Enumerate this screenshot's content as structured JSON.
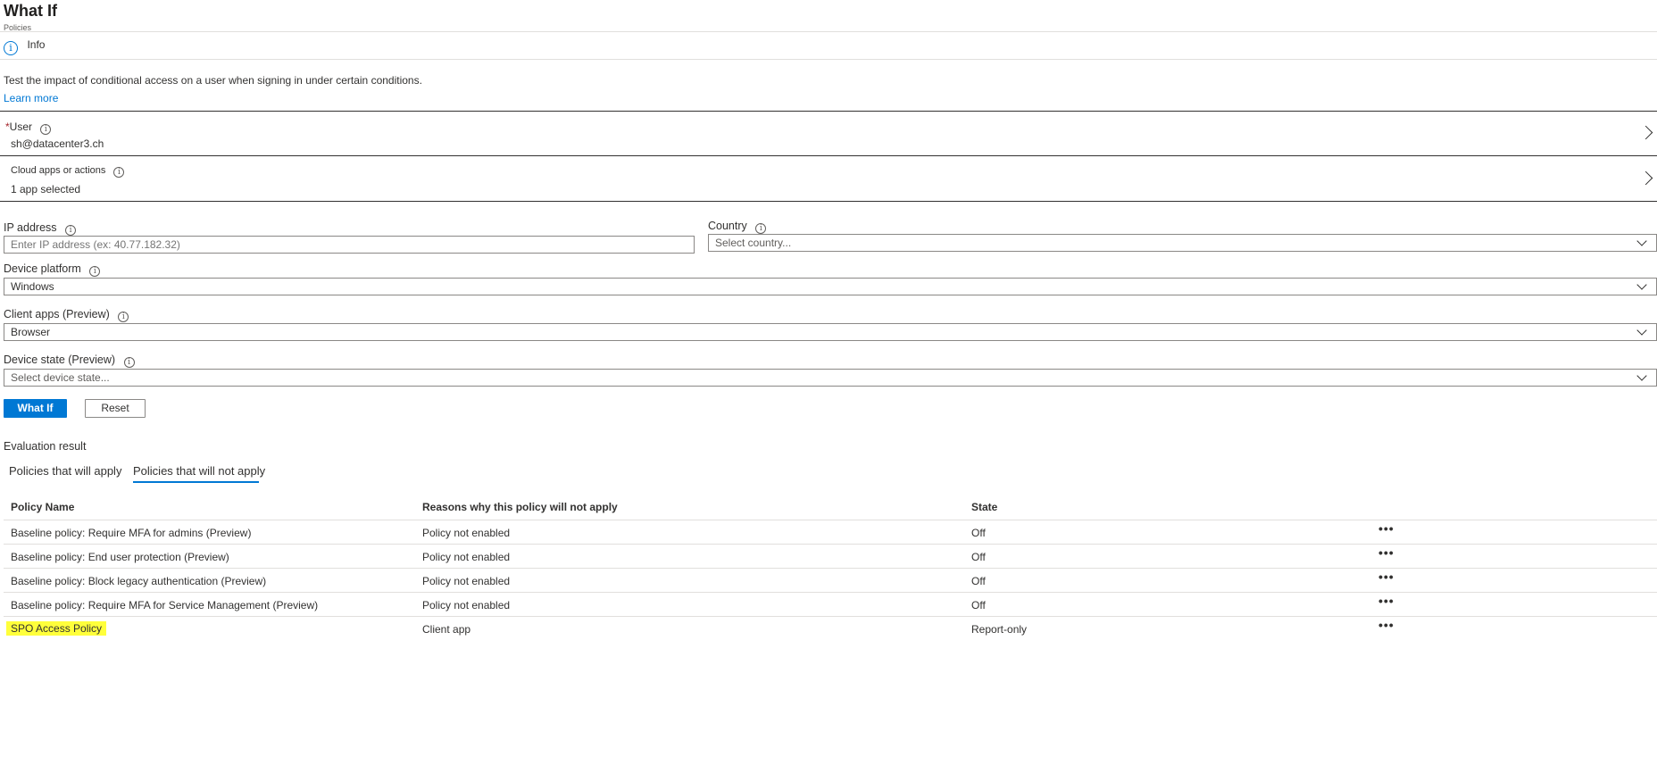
{
  "header": {
    "title": "What If",
    "subtitle": "Policies"
  },
  "info_bar": {
    "label": "Info",
    "icon": "info-icon"
  },
  "description": {
    "text": "Test the impact of conditional access on a user when signing in under certain conditions.",
    "link": "Learn more"
  },
  "user_field": {
    "required_mark": "*",
    "label": "User",
    "value": "sh@datacenter3.ch"
  },
  "cloud_apps_field": {
    "label": "Cloud apps or actions",
    "value": "1 app selected"
  },
  "ip_address": {
    "label": "IP address",
    "placeholder": "Enter IP address (ex: 40.77.182.32)"
  },
  "country": {
    "label": "Country",
    "placeholder": "Select country..."
  },
  "device_platform": {
    "label": "Device platform",
    "value": "Windows"
  },
  "client_apps": {
    "label": "Client apps (Preview)",
    "value": "Browser"
  },
  "device_state": {
    "label": "Device state (Preview)",
    "placeholder": "Select device state..."
  },
  "buttons": {
    "what_if": "What If",
    "reset": "Reset"
  },
  "evaluation": {
    "heading": "Evaluation result",
    "tabs": [
      {
        "label": "Policies that will apply",
        "active": false
      },
      {
        "label": "Policies that will not apply",
        "active": true
      }
    ]
  },
  "table": {
    "columns": [
      "Policy Name",
      "Reasons why this policy will not apply",
      "State"
    ],
    "rows": [
      {
        "name": "Baseline policy: Require MFA for admins (Preview)",
        "reason": "Policy not enabled",
        "state": "Off",
        "more": "•••"
      },
      {
        "name": "Baseline policy: End user protection (Preview)",
        "reason": "Policy not enabled",
        "state": "Off",
        "more": "•••"
      },
      {
        "name": "Baseline policy: Block legacy authentication (Preview)",
        "reason": "Policy not enabled",
        "state": "Off",
        "more": "•••"
      },
      {
        "name": "Baseline policy: Require MFA for Service Management (Preview)",
        "reason": "Policy not enabled",
        "state": "Off",
        "more": "•••"
      },
      {
        "name": "SPO Access Policy",
        "reason": "Client app",
        "state": "Report-only",
        "more": "•••",
        "highlight_color": "#ffff3b"
      }
    ]
  },
  "colors": {
    "accent": "#0078d4",
    "highlight": "#ffff3b"
  }
}
